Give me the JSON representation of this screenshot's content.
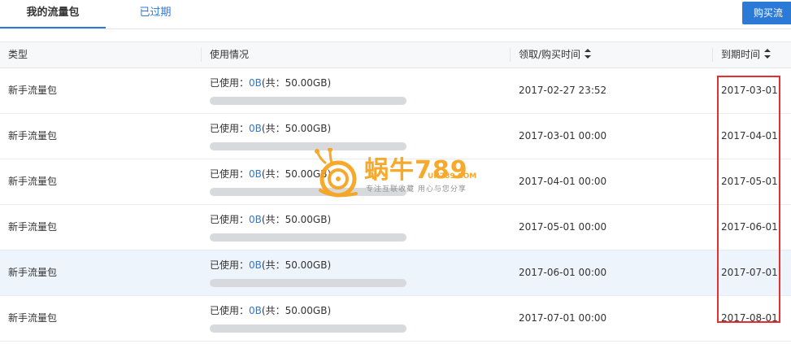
{
  "tabs": {
    "active_label": "我的流量包",
    "expired_label": "已过期"
  },
  "buy_button_label": "购买流",
  "table": {
    "headers": {
      "type": "类型",
      "usage": "使用情况",
      "purchase_time": "领取/购买时间",
      "expire_time": "到期时间"
    },
    "rows": [
      {
        "type": "新手流量包",
        "usage_prefix": "已使用：",
        "used": "0B",
        "total": "(共：50.00GB)",
        "used_fraction": 0,
        "purchase_time": "2017-02-27 23:52",
        "expire_time": "2017-03-01"
      },
      {
        "type": "新手流量包",
        "usage_prefix": "已使用：",
        "used": "0B",
        "total": "(共：50.00GB)",
        "used_fraction": 0,
        "purchase_time": "2017-03-01 00:00",
        "expire_time": "2017-04-01"
      },
      {
        "type": "新手流量包",
        "usage_prefix": "已使用：",
        "used": "0B",
        "total": "(共：50.00GB)",
        "used_fraction": 0,
        "purchase_time": "2017-04-01 00:00",
        "expire_time": "2017-05-01"
      },
      {
        "type": "新手流量包",
        "usage_prefix": "已使用：",
        "used": "0B",
        "total": "(共：50.00GB)",
        "used_fraction": 0,
        "purchase_time": "2017-05-01 00:00",
        "expire_time": "2017-06-01"
      },
      {
        "type": "新手流量包",
        "usage_prefix": "已使用：",
        "used": "0B",
        "total": "(共：50.00GB)",
        "used_fraction": 0,
        "purchase_time": "2017-06-01 00:00",
        "expire_time": "2017-07-01"
      },
      {
        "type": "新手流量包",
        "usage_prefix": "已使用：",
        "used": "0B",
        "total": "(共：50.00GB)",
        "used_fraction": 0,
        "purchase_time": "2017-07-01 00:00",
        "expire_time": "2017-08-01"
      }
    ]
  },
  "watermark": {
    "main": "蜗牛789",
    "url": "UN789.COM",
    "slogan": "专注互联收藏   用心与您分享"
  },
  "colors": {
    "accent": "#2b7ad8",
    "annotation": "#e53030",
    "watermark": "#f7a21a"
  }
}
